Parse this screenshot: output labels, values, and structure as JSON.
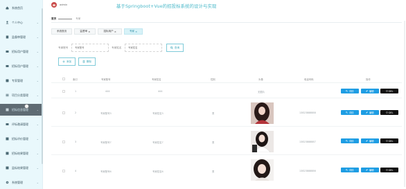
{
  "sidebar": {
    "items": [
      {
        "label": "系统首页",
        "icon": "home-icon",
        "has_arrow": false
      },
      {
        "label": "个人中心",
        "icon": "user-icon",
        "has_arrow": true
      },
      {
        "label": "监督审管理",
        "icon": "doc-icon",
        "has_arrow": true
      },
      {
        "label": "招标用户管理",
        "icon": "people-icon",
        "has_arrow": true
      },
      {
        "label": "招标用户管理",
        "icon": "people-icon",
        "has_arrow": true
      },
      {
        "label": "专家管理",
        "icon": "expert-icon",
        "has_arrow": true
      },
      {
        "label": "项目分类管理",
        "icon": "list-icon",
        "has_arrow": true
      },
      {
        "label": "招标信息管理",
        "icon": "info-icon",
        "has_arrow": true,
        "active": true
      },
      {
        "label": "评标邀请管理",
        "icon": "mail-icon",
        "has_arrow": true
      },
      {
        "label": "招标评价管理",
        "icon": "star-icon",
        "has_arrow": true
      },
      {
        "label": "招标结果管理",
        "icon": "flag-icon",
        "has_arrow": true
      },
      {
        "label": "监标结果管理",
        "icon": "check-icon",
        "has_arrow": true
      },
      {
        "label": "系统管理",
        "icon": "gear-icon",
        "has_arrow": true
      }
    ]
  },
  "header": {
    "username": "admin",
    "title": "基于Springboot+Vue的招投标系统的设计与实现"
  },
  "breadcrumb": {
    "home": "首页",
    "current": "专家"
  },
  "tabs": [
    {
      "label": "系统首页",
      "active": false
    },
    {
      "label": "监督审",
      "active": false,
      "closable": true
    },
    {
      "label": "招标用户",
      "active": false,
      "closable": true
    },
    {
      "label": "专家",
      "active": true,
      "closable": true
    }
  ],
  "search": {
    "field1_label": "专家账号",
    "field1_placeholder": "专家账号",
    "field2_label": "专家姓名",
    "field2_placeholder": "专家姓名",
    "button": "查询"
  },
  "ops": {
    "add": "添加",
    "delete": "删除"
  },
  "table": {
    "columns": [
      "索引",
      "专家账号",
      "专家姓名",
      "性别",
      "头像",
      "电话号码",
      "操作"
    ],
    "rows": [
      {
        "index": "1",
        "account": "444",
        "name": "444",
        "gender": "",
        "photo_text": "无图片",
        "phone": "",
        "has_photo": false
      },
      {
        "index": "2",
        "account": "专家账号3",
        "name": "专家姓名3",
        "gender": "男",
        "photo_text": "",
        "phone": "13823888888",
        "has_photo": true
      },
      {
        "index": "3",
        "account": "专家账号7",
        "name": "专家姓名7",
        "gender": "男",
        "photo_text": "",
        "phone": "13823888887",
        "has_photo": true
      },
      {
        "index": "4",
        "account": "专家账号6",
        "name": "专家姓名6",
        "gender": "男",
        "photo_text": "",
        "phone": "13823888886",
        "has_photo": true
      }
    ],
    "actions": {
      "detail": "详情",
      "edit": "编辑",
      "delete": "DEL"
    }
  },
  "colors": {
    "accent": "#4ab8c9",
    "sidebar_bg": "#e9f8fc",
    "active_item": "#5f6b73",
    "action_blue": "#1e9de3"
  }
}
